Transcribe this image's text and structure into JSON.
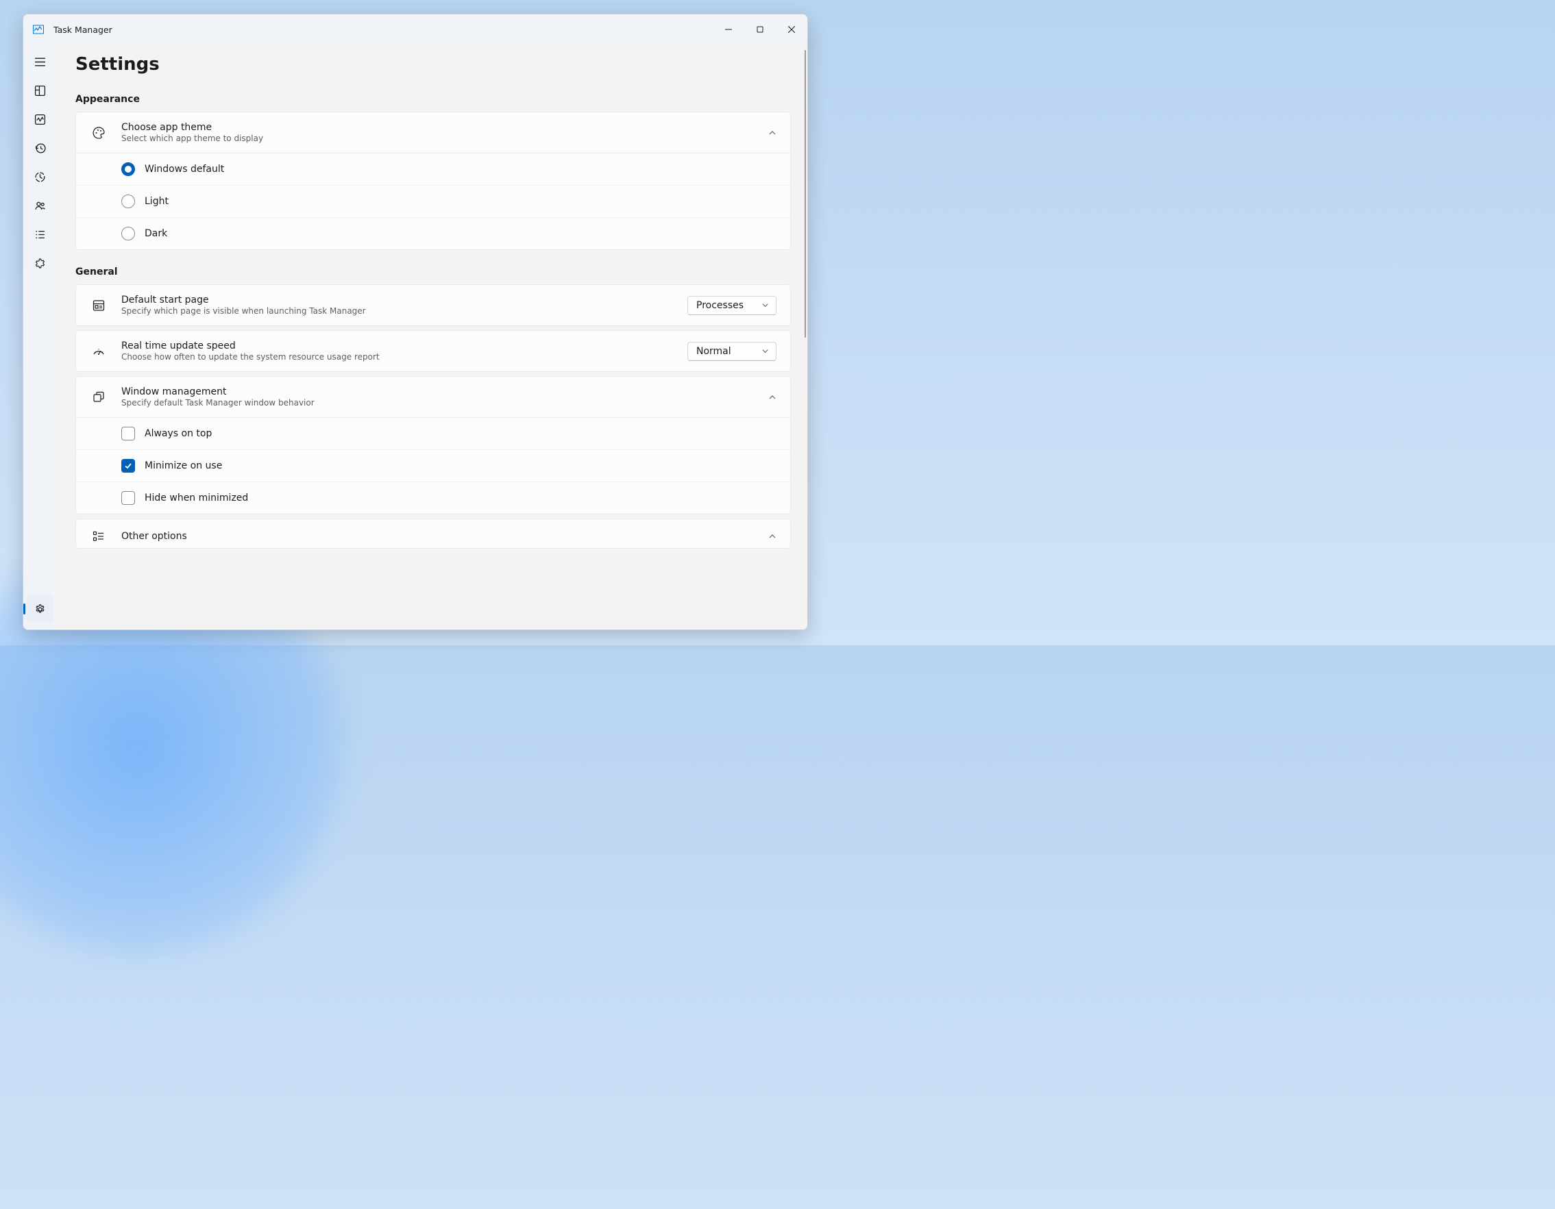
{
  "app": {
    "title": "Task Manager"
  },
  "page": {
    "title": "Settings"
  },
  "sections": {
    "appearance": {
      "label": "Appearance",
      "theme": {
        "title": "Choose app theme",
        "subtitle": "Select which app theme to display",
        "options": {
          "windows_default": "Windows default",
          "light": "Light",
          "dark": "Dark"
        }
      }
    },
    "general": {
      "label": "General",
      "start_page": {
        "title": "Default start page",
        "subtitle": "Specify which page is visible when launching Task Manager",
        "value": "Processes"
      },
      "update_speed": {
        "title": "Real time update speed",
        "subtitle": "Choose how often to update the system resource usage report",
        "value": "Normal"
      },
      "window_mgmt": {
        "title": "Window management",
        "subtitle": "Specify default Task Manager window behavior",
        "options": {
          "always_on_top": "Always on top",
          "minimize_on_use": "Minimize on use",
          "hide_when_minimized": "Hide when minimized"
        }
      },
      "other": {
        "title": "Other options"
      }
    }
  }
}
